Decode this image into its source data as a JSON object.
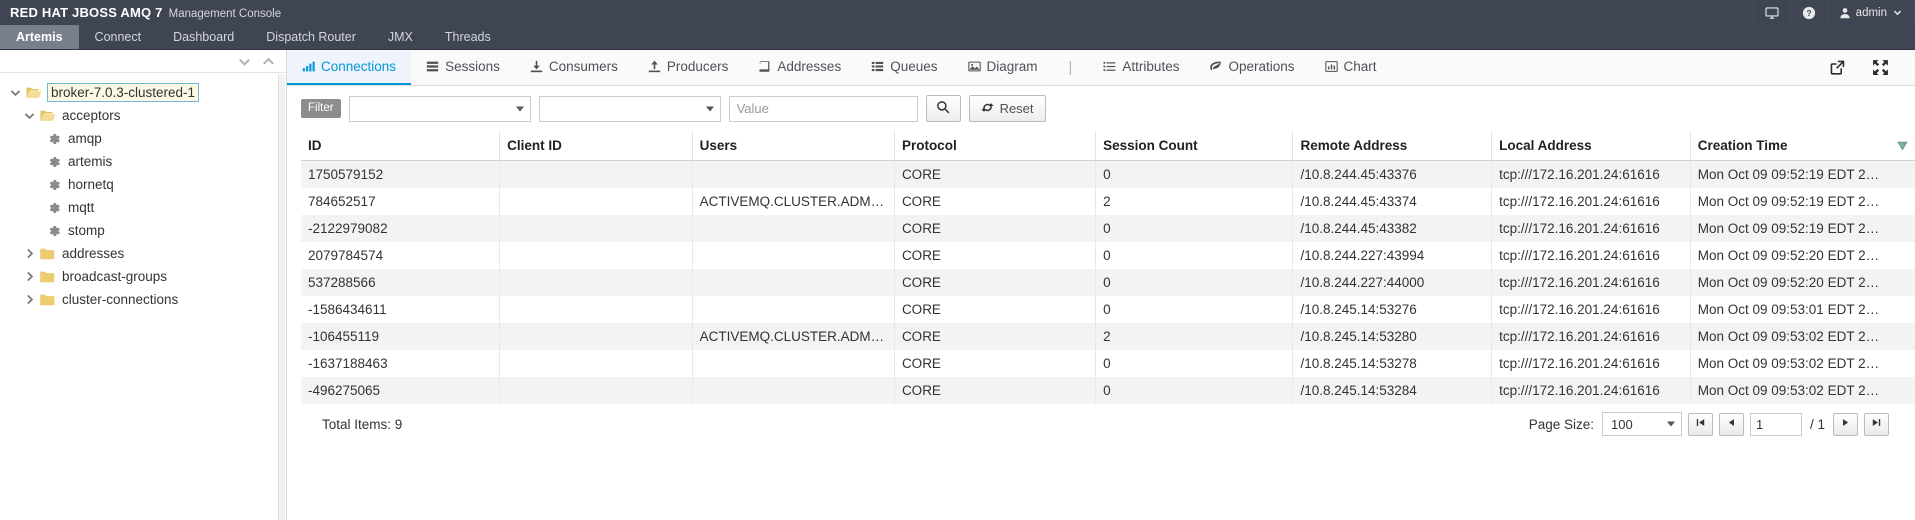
{
  "masthead": {
    "brand_strong": "RED HAT JBOSS AMQ 7",
    "brand_sub": "Management Console",
    "screen_icon": "monitor-icon",
    "help_icon": "help-circle-icon",
    "user_label": "admin",
    "user_icon": "user-icon",
    "user_caret_icon": "chevron-down-icon"
  },
  "nav_primary": {
    "tabs": [
      {
        "label": "Artemis",
        "active": true
      },
      {
        "label": "Connect",
        "active": false
      },
      {
        "label": "Dashboard",
        "active": false
      },
      {
        "label": "Dispatch Router",
        "active": false
      },
      {
        "label": "JMX",
        "active": false
      },
      {
        "label": "Threads",
        "active": false
      }
    ]
  },
  "sidebar": {
    "collapse_all_icon": "chevron-down-icon",
    "expand_all_icon": "chevron-up-icon",
    "tree": [
      {
        "label": "broker-7.0.3-clustered-1",
        "depth": 0,
        "twisty": "down",
        "icon": "folder-open-icon",
        "selected": true
      },
      {
        "label": "acceptors",
        "depth": 1,
        "twisty": "down",
        "icon": "folder-open-icon",
        "selected": false
      },
      {
        "label": "amqp",
        "depth": 2,
        "twisty": "none",
        "icon": "gear-icon",
        "selected": false
      },
      {
        "label": "artemis",
        "depth": 2,
        "twisty": "none",
        "icon": "gear-icon",
        "selected": false
      },
      {
        "label": "hornetq",
        "depth": 2,
        "twisty": "none",
        "icon": "gear-icon",
        "selected": false
      },
      {
        "label": "mqtt",
        "depth": 2,
        "twisty": "none",
        "icon": "gear-icon",
        "selected": false
      },
      {
        "label": "stomp",
        "depth": 2,
        "twisty": "none",
        "icon": "gear-icon",
        "selected": false
      },
      {
        "label": "addresses",
        "depth": 1,
        "twisty": "right",
        "icon": "folder-icon",
        "selected": false
      },
      {
        "label": "broadcast-groups",
        "depth": 1,
        "twisty": "right",
        "icon": "folder-icon",
        "selected": false
      },
      {
        "label": "cluster-connections",
        "depth": 1,
        "twisty": "right",
        "icon": "folder-icon",
        "selected": false
      }
    ]
  },
  "subnav": {
    "tabs": [
      {
        "label": "Connections",
        "icon": "bar-chart-icon",
        "active": true
      },
      {
        "label": "Sessions",
        "icon": "list-rows-icon",
        "active": false
      },
      {
        "label": "Consumers",
        "icon": "download-icon",
        "active": false
      },
      {
        "label": "Producers",
        "icon": "upload-icon",
        "active": false
      },
      {
        "label": "Addresses",
        "icon": "book-icon",
        "active": false
      },
      {
        "label": "Queues",
        "icon": "th-list-icon",
        "active": false
      },
      {
        "label": "Diagram",
        "icon": "image-icon",
        "active": false
      }
    ],
    "separator": "|",
    "tabs_right": [
      {
        "label": "Attributes",
        "icon": "list-icon",
        "active": false
      },
      {
        "label": "Operations",
        "icon": "leaf-icon",
        "active": false
      },
      {
        "label": "Chart",
        "icon": "chart-icon",
        "active": false
      }
    ],
    "share_icon": "share-external-icon",
    "fullscreen_icon": "expand-arrows-icon"
  },
  "filterbar": {
    "tag_label": "Filter",
    "field_select_value": "",
    "operator_select_value": "",
    "value_placeholder": "Value",
    "value_text": "",
    "search_icon": "search-icon",
    "reset_label": "Reset",
    "reset_icon": "refresh-icon"
  },
  "table": {
    "columns": [
      "ID",
      "Client ID",
      "Users",
      "Protocol",
      "Session Count",
      "Remote Address",
      "Local Address",
      "Creation Time"
    ],
    "header_filter_icon": "funnel-caret-icon",
    "rows": [
      {
        "id": "1750579152",
        "client_id": "",
        "users": "",
        "protocol": "CORE",
        "session_count": "0",
        "remote_address": "/10.8.244.45:43376",
        "local_address": "tcp:///172.16.201.24:61616",
        "creation_time": "Mon Oct 09 09:52:19 EDT 2…"
      },
      {
        "id": "784652517",
        "client_id": "",
        "users": "ACTIVEMQ.CLUSTER.ADMI…",
        "protocol": "CORE",
        "session_count": "2",
        "remote_address": "/10.8.244.45:43374",
        "local_address": "tcp:///172.16.201.24:61616",
        "creation_time": "Mon Oct 09 09:52:19 EDT 2…"
      },
      {
        "id": "-2122979082",
        "client_id": "",
        "users": "",
        "protocol": "CORE",
        "session_count": "0",
        "remote_address": "/10.8.244.45:43382",
        "local_address": "tcp:///172.16.201.24:61616",
        "creation_time": "Mon Oct 09 09:52:19 EDT 2…"
      },
      {
        "id": "2079784574",
        "client_id": "",
        "users": "",
        "protocol": "CORE",
        "session_count": "0",
        "remote_address": "/10.8.244.227:43994",
        "local_address": "tcp:///172.16.201.24:61616",
        "creation_time": "Mon Oct 09 09:52:20 EDT 2…"
      },
      {
        "id": "537288566",
        "client_id": "",
        "users": "",
        "protocol": "CORE",
        "session_count": "0",
        "remote_address": "/10.8.244.227:44000",
        "local_address": "tcp:///172.16.201.24:61616",
        "creation_time": "Mon Oct 09 09:52:20 EDT 2…"
      },
      {
        "id": "-1586434611",
        "client_id": "",
        "users": "",
        "protocol": "CORE",
        "session_count": "0",
        "remote_address": "/10.8.245.14:53276",
        "local_address": "tcp:///172.16.201.24:61616",
        "creation_time": "Mon Oct 09 09:53:01 EDT 2…"
      },
      {
        "id": "-106455119",
        "client_id": "",
        "users": "ACTIVEMQ.CLUSTER.ADMI…",
        "protocol": "CORE",
        "session_count": "2",
        "remote_address": "/10.8.245.14:53280",
        "local_address": "tcp:///172.16.201.24:61616",
        "creation_time": "Mon Oct 09 09:53:02 EDT 2…"
      },
      {
        "id": "-1637188463",
        "client_id": "",
        "users": "",
        "protocol": "CORE",
        "session_count": "0",
        "remote_address": "/10.8.245.14:53278",
        "local_address": "tcp:///172.16.201.24:61616",
        "creation_time": "Mon Oct 09 09:53:02 EDT 2…"
      },
      {
        "id": "-496275065",
        "client_id": "",
        "users": "",
        "protocol": "CORE",
        "session_count": "0",
        "remote_address": "/10.8.245.14:53284",
        "local_address": "tcp:///172.16.201.24:61616",
        "creation_time": "Mon Oct 09 09:53:02 EDT 2…"
      }
    ]
  },
  "footer": {
    "total_items": "Total Items: 9",
    "page_size_label": "Page Size:",
    "page_size_value": "100",
    "first_page_icon": "step-backward-icon",
    "prev_page_icon": "caret-left-icon",
    "page_number": "1",
    "page_total": "/ 1",
    "next_page_icon": "caret-right-icon",
    "last_page_icon": "step-forward-icon"
  },
  "colors": {
    "masthead_bg": "#3f4552",
    "active_tab_bg": "#787f8c",
    "link_blue": "#0099d3",
    "filter_tag_bg": "#8b8d8f",
    "folder_yellow": "#ecc85b",
    "header_filter_green": "#7bb0a4"
  }
}
